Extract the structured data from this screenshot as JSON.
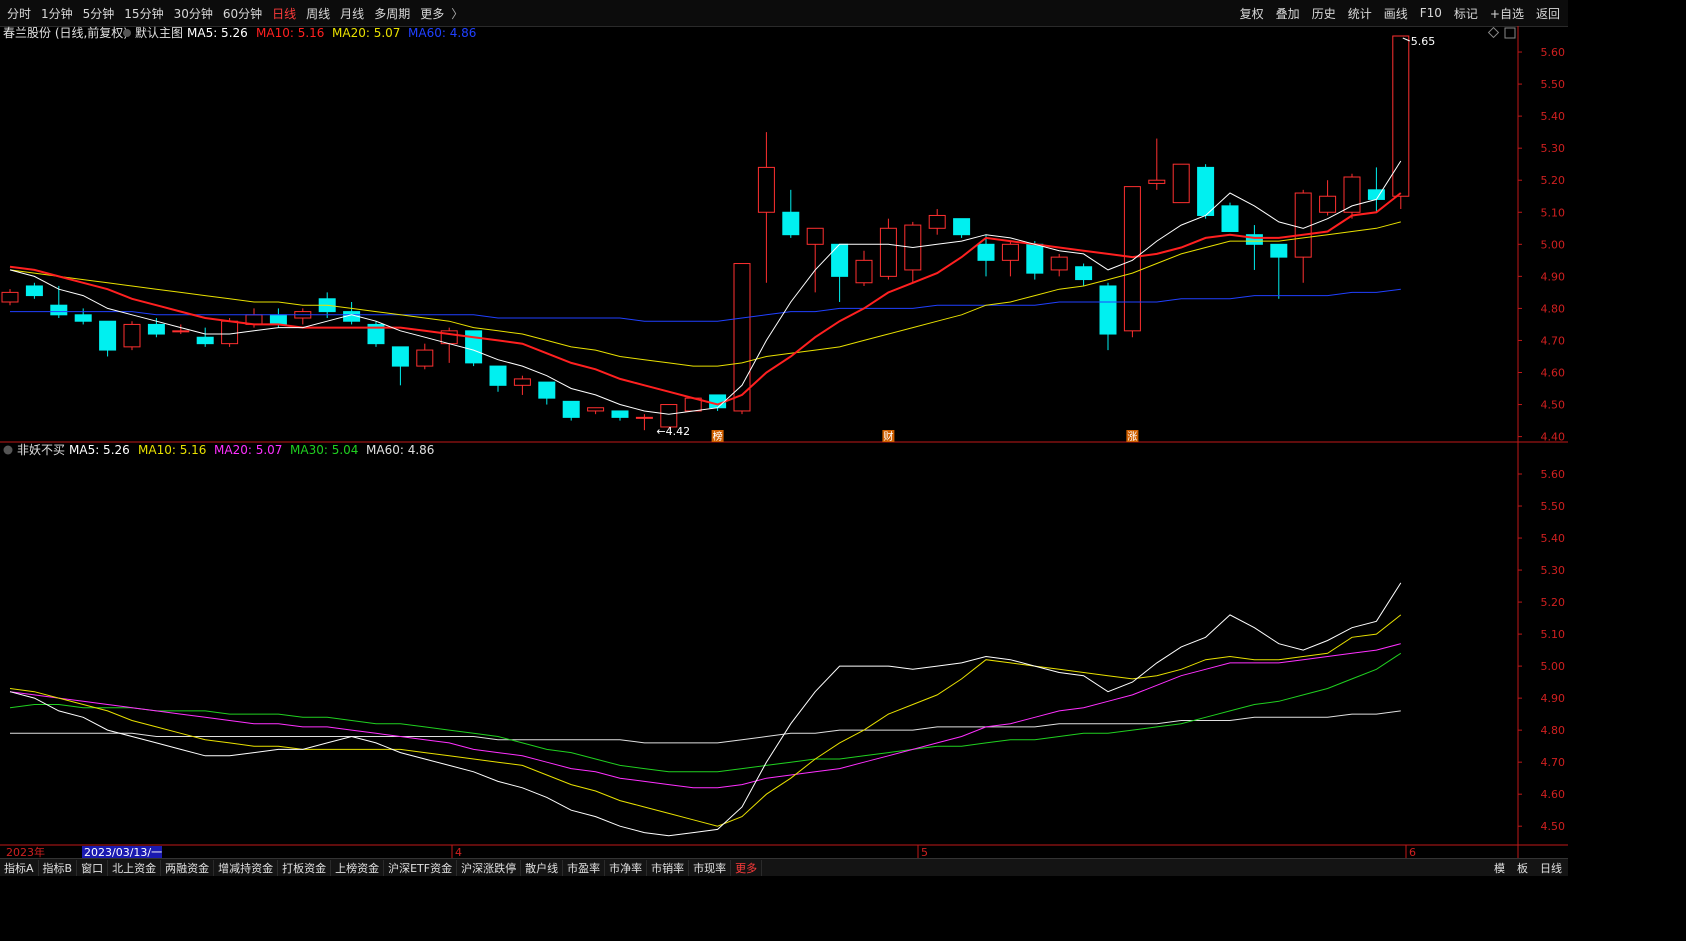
{
  "toolbar": {
    "periods": [
      "分时",
      "1分钟",
      "5分钟",
      "15分钟",
      "30分钟",
      "60分钟",
      "日线",
      "周线",
      "月线",
      "多周期",
      "更多"
    ],
    "active_period": "日线",
    "more_label": "更多",
    "right_buttons": [
      "复权",
      "叠加",
      "历史",
      "统计",
      "画线",
      "F10",
      "标记",
      "+自选",
      "返回"
    ]
  },
  "main_panel": {
    "title": "春兰股份 (日线,前复权)",
    "subtitle": "默认主图",
    "ma_labels": [
      {
        "text": "MA5: 5.26",
        "color": "#ffffff"
      },
      {
        "text": "MA10: 5.16",
        "color": "#ff2020"
      },
      {
        "text": "MA20: 5.07",
        "color": "#e8e000"
      },
      {
        "text": "MA60: 4.86",
        "color": "#2040ff"
      }
    ],
    "high_label": "5.65",
    "low_label": "4.42",
    "markers": [
      "榜",
      "财",
      "涨"
    ]
  },
  "sub_panel": {
    "title": "非妖不买",
    "ma_labels": [
      {
        "text": "MA5: 5.26",
        "color": "#ffffff"
      },
      {
        "text": "MA10: 5.16",
        "color": "#e8e000"
      },
      {
        "text": "MA20: 5.07",
        "color": "#ff30ff"
      },
      {
        "text": "MA30: 5.04",
        "color": "#20d020"
      },
      {
        "text": "MA60: 4.86",
        "color": "#e0e0e0"
      }
    ]
  },
  "x_axis": {
    "year_label": "2023年",
    "cursor_label": "2023/03/13/一",
    "month_labels": [
      "4",
      "5",
      "6"
    ]
  },
  "bottom_bar": {
    "items": [
      "指标A",
      "指标B",
      "窗口",
      "北上资金",
      "两融资金",
      "增减持资金",
      "打板资金",
      "上榜资金",
      "沪深ETF资金",
      "沪深涨跌停",
      "散户线",
      "市盈率",
      "市净率",
      "市销率",
      "市现率",
      "更多"
    ],
    "right": [
      "模",
      "板",
      "日线"
    ]
  },
  "colors": {
    "up": "#ff3030",
    "down": "#00f0f0",
    "ma5": "#ffffff",
    "ma10": "#ff2020",
    "ma20": "#e8e000",
    "ma60": "#2040ff",
    "sub_ma10": "#e8e000",
    "sub_ma20": "#ff30ff",
    "sub_ma30": "#20d020",
    "sub_ma60": "#e0e0e0"
  },
  "chart_data": [
    {
      "type": "candlestick",
      "title": "春兰股份 (日线,前复权)",
      "ylim": [
        4.38,
        5.65
      ],
      "y_ticks": [
        5.6,
        5.5,
        5.4,
        5.3,
        5.2,
        5.1,
        5.0,
        4.9,
        4.8,
        4.7,
        4.6,
        4.5,
        4.4
      ],
      "candles": [
        {
          "o": 4.82,
          "h": 4.86,
          "l": 4.81,
          "c": 4.85
        },
        {
          "o": 4.87,
          "h": 4.88,
          "l": 4.83,
          "c": 4.84
        },
        {
          "o": 4.81,
          "h": 4.87,
          "l": 4.77,
          "c": 4.78
        },
        {
          "o": 4.78,
          "h": 4.8,
          "l": 4.75,
          "c": 4.76
        },
        {
          "o": 4.76,
          "h": 4.76,
          "l": 4.65,
          "c": 4.67
        },
        {
          "o": 4.68,
          "h": 4.76,
          "l": 4.67,
          "c": 4.75
        },
        {
          "o": 4.75,
          "h": 4.77,
          "l": 4.71,
          "c": 4.72
        },
        {
          "o": 4.73,
          "h": 4.75,
          "l": 4.72,
          "c": 4.73
        },
        {
          "o": 4.71,
          "h": 4.74,
          "l": 4.68,
          "c": 4.69
        },
        {
          "o": 4.69,
          "h": 4.77,
          "l": 4.68,
          "c": 4.76
        },
        {
          "o": 4.75,
          "h": 4.8,
          "l": 4.74,
          "c": 4.78
        },
        {
          "o": 4.78,
          "h": 4.8,
          "l": 4.74,
          "c": 4.75
        },
        {
          "o": 4.77,
          "h": 4.8,
          "l": 4.75,
          "c": 4.79
        },
        {
          "o": 4.83,
          "h": 4.85,
          "l": 4.77,
          "c": 4.79
        },
        {
          "o": 4.79,
          "h": 4.82,
          "l": 4.75,
          "c": 4.76
        },
        {
          "o": 4.75,
          "h": 4.76,
          "l": 4.68,
          "c": 4.69
        },
        {
          "o": 4.68,
          "h": 4.68,
          "l": 4.56,
          "c": 4.62
        },
        {
          "o": 4.62,
          "h": 4.69,
          "l": 4.61,
          "c": 4.67
        },
        {
          "o": 4.69,
          "h": 4.74,
          "l": 4.63,
          "c": 4.73
        },
        {
          "o": 4.73,
          "h": 4.73,
          "l": 4.62,
          "c": 4.63
        },
        {
          "o": 4.62,
          "h": 4.62,
          "l": 4.54,
          "c": 4.56
        },
        {
          "o": 4.56,
          "h": 4.59,
          "l": 4.53,
          "c": 4.58
        },
        {
          "o": 4.57,
          "h": 4.57,
          "l": 4.5,
          "c": 4.52
        },
        {
          "o": 4.51,
          "h": 4.51,
          "l": 4.45,
          "c": 4.46
        },
        {
          "o": 4.48,
          "h": 4.49,
          "l": 4.47,
          "c": 4.49
        },
        {
          "o": 4.48,
          "h": 4.48,
          "l": 4.45,
          "c": 4.46
        },
        {
          "o": 4.46,
          "h": 4.47,
          "l": 4.42,
          "c": 4.46
        },
        {
          "o": 4.43,
          "h": 4.5,
          "l": 4.43,
          "c": 4.5
        },
        {
          "o": 4.48,
          "h": 4.52,
          "l": 4.48,
          "c": 4.52
        },
        {
          "o": 4.53,
          "h": 4.53,
          "l": 4.48,
          "c": 4.49
        },
        {
          "o": 4.48,
          "h": 4.94,
          "l": 4.47,
          "c": 4.94
        },
        {
          "o": 5.1,
          "h": 5.35,
          "l": 4.88,
          "c": 5.24
        },
        {
          "o": 5.1,
          "h": 5.17,
          "l": 5.02,
          "c": 5.03
        },
        {
          "o": 5.0,
          "h": 5.05,
          "l": 4.85,
          "c": 5.05
        },
        {
          "o": 5.0,
          "h": 5.0,
          "l": 4.82,
          "c": 4.9
        },
        {
          "o": 4.88,
          "h": 4.98,
          "l": 4.87,
          "c": 4.95
        },
        {
          "o": 4.9,
          "h": 5.08,
          "l": 4.89,
          "c": 5.05
        },
        {
          "o": 4.92,
          "h": 5.07,
          "l": 4.88,
          "c": 5.06
        },
        {
          "o": 5.05,
          "h": 5.11,
          "l": 5.03,
          "c": 5.09
        },
        {
          "o": 5.08,
          "h": 5.08,
          "l": 5.02,
          "c": 5.03
        },
        {
          "o": 5.0,
          "h": 5.03,
          "l": 4.9,
          "c": 4.95
        },
        {
          "o": 4.95,
          "h": 5.01,
          "l": 4.9,
          "c": 5.0
        },
        {
          "o": 5.0,
          "h": 5.01,
          "l": 4.89,
          "c": 4.91
        },
        {
          "o": 4.92,
          "h": 4.97,
          "l": 4.9,
          "c": 4.96
        },
        {
          "o": 4.93,
          "h": 4.94,
          "l": 4.87,
          "c": 4.89
        },
        {
          "o": 4.87,
          "h": 4.88,
          "l": 4.67,
          "c": 4.72
        },
        {
          "o": 4.73,
          "h": 5.18,
          "l": 4.71,
          "c": 5.18
        },
        {
          "o": 5.19,
          "h": 5.33,
          "l": 5.17,
          "c": 5.2
        },
        {
          "o": 5.13,
          "h": 5.25,
          "l": 5.13,
          "c": 5.25
        },
        {
          "o": 5.24,
          "h": 5.25,
          "l": 5.08,
          "c": 5.09
        },
        {
          "o": 5.12,
          "h": 5.13,
          "l": 5.04,
          "c": 5.04
        },
        {
          "o": 5.03,
          "h": 5.06,
          "l": 4.92,
          "c": 5.0
        },
        {
          "o": 5.0,
          "h": 5.0,
          "l": 4.83,
          "c": 4.96
        },
        {
          "o": 4.96,
          "h": 5.17,
          "l": 4.88,
          "c": 5.16
        },
        {
          "o": 5.1,
          "h": 5.2,
          "l": 5.09,
          "c": 5.15
        },
        {
          "o": 5.1,
          "h": 5.22,
          "l": 5.08,
          "c": 5.21
        },
        {
          "o": 5.17,
          "h": 5.24,
          "l": 5.1,
          "c": 5.14
        },
        {
          "o": 5.15,
          "h": 5.65,
          "l": 5.11,
          "c": 5.65
        }
      ],
      "ma5": [
        4.92,
        4.9,
        4.86,
        4.84,
        4.8,
        4.78,
        4.76,
        4.74,
        4.72,
        4.72,
        4.73,
        4.74,
        4.74,
        4.76,
        4.78,
        4.76,
        4.73,
        4.71,
        4.69,
        4.67,
        4.64,
        4.62,
        4.59,
        4.55,
        4.53,
        4.5,
        4.48,
        4.47,
        4.48,
        4.49,
        4.56,
        4.7,
        4.82,
        4.92,
        5.0,
        5.0,
        5.0,
        4.99,
        5.0,
        5.01,
        5.03,
        5.02,
        5.0,
        4.98,
        4.97,
        4.92,
        4.95,
        5.01,
        5.06,
        5.09,
        5.16,
        5.12,
        5.07,
        5.05,
        5.08,
        5.12,
        5.14,
        5.26
      ],
      "ma10": [
        4.93,
        4.92,
        4.9,
        4.88,
        4.86,
        4.83,
        4.81,
        4.79,
        4.77,
        4.76,
        4.75,
        4.75,
        4.74,
        4.74,
        4.74,
        4.74,
        4.74,
        4.73,
        4.72,
        4.71,
        4.7,
        4.69,
        4.66,
        4.63,
        4.61,
        4.58,
        4.56,
        4.54,
        4.52,
        4.5,
        4.53,
        4.6,
        4.65,
        4.71,
        4.76,
        4.8,
        4.85,
        4.88,
        4.91,
        4.96,
        5.02,
        5.01,
        5.0,
        4.99,
        4.98,
        4.97,
        4.96,
        4.97,
        4.99,
        5.02,
        5.03,
        5.02,
        5.02,
        5.03,
        5.04,
        5.09,
        5.1,
        5.16
      ],
      "ma20": [
        4.92,
        4.91,
        4.9,
        4.89,
        4.88,
        4.87,
        4.86,
        4.85,
        4.84,
        4.83,
        4.82,
        4.82,
        4.81,
        4.81,
        4.8,
        4.79,
        4.78,
        4.77,
        4.76,
        4.74,
        4.73,
        4.72,
        4.7,
        4.68,
        4.67,
        4.65,
        4.64,
        4.63,
        4.62,
        4.62,
        4.63,
        4.65,
        4.66,
        4.67,
        4.68,
        4.7,
        4.72,
        4.74,
        4.76,
        4.78,
        4.81,
        4.82,
        4.84,
        4.86,
        4.87,
        4.89,
        4.91,
        4.94,
        4.97,
        4.99,
        5.01,
        5.01,
        5.01,
        5.02,
        5.03,
        5.04,
        5.05,
        5.07
      ],
      "ma60": [
        4.79,
        4.79,
        4.79,
        4.79,
        4.79,
        4.79,
        4.78,
        4.78,
        4.78,
        4.78,
        4.78,
        4.78,
        4.78,
        4.78,
        4.78,
        4.78,
        4.78,
        4.78,
        4.78,
        4.78,
        4.77,
        4.77,
        4.77,
        4.77,
        4.77,
        4.77,
        4.76,
        4.76,
        4.76,
        4.76,
        4.77,
        4.78,
        4.79,
        4.79,
        4.8,
        4.8,
        4.8,
        4.8,
        4.81,
        4.81,
        4.81,
        4.81,
        4.81,
        4.82,
        4.82,
        4.82,
        4.82,
        4.82,
        4.83,
        4.83,
        4.83,
        4.84,
        4.84,
        4.84,
        4.84,
        4.85,
        4.85,
        4.86
      ],
      "marker_indices": [
        29,
        36,
        46
      ]
    },
    {
      "type": "line",
      "title": "非妖不买",
      "ylim": [
        4.46,
        5.65
      ],
      "y_ticks": [
        5.6,
        5.5,
        5.4,
        5.3,
        5.2,
        5.1,
        5.0,
        4.9,
        4.8,
        4.7,
        4.6,
        4.5
      ],
      "series_ref": [
        "ma5",
        "ma10",
        "ma20",
        "ma30",
        "ma60"
      ],
      "ma30": [
        4.87,
        4.88,
        4.88,
        4.87,
        4.87,
        4.87,
        4.86,
        4.86,
        4.86,
        4.85,
        4.85,
        4.85,
        4.84,
        4.84,
        4.83,
        4.82,
        4.82,
        4.81,
        4.8,
        4.79,
        4.78,
        4.76,
        4.74,
        4.73,
        4.71,
        4.69,
        4.68,
        4.67,
        4.67,
        4.67,
        4.68,
        4.69,
        4.7,
        4.71,
        4.71,
        4.72,
        4.73,
        4.74,
        4.75,
        4.75,
        4.76,
        4.77,
        4.77,
        4.78,
        4.79,
        4.79,
        4.8,
        4.81,
        4.82,
        4.84,
        4.86,
        4.88,
        4.89,
        4.91,
        4.93,
        4.96,
        4.99,
        5.04
      ]
    }
  ]
}
